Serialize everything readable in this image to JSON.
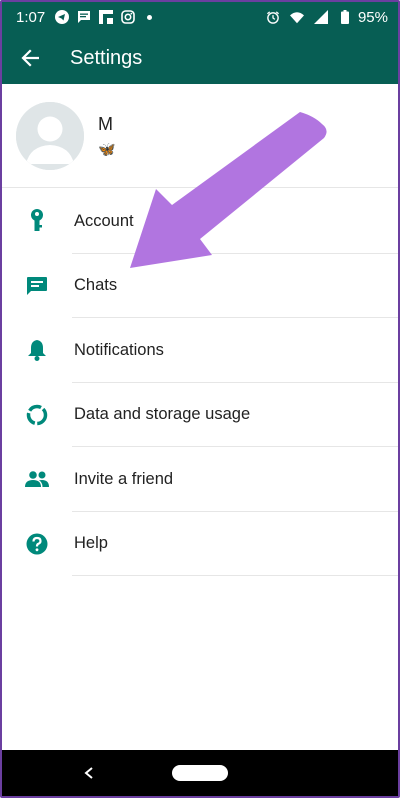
{
  "status_bar": {
    "time": "1:07",
    "battery": "95%",
    "icons": [
      "telegram-icon",
      "message-icon",
      "flipboard-icon",
      "instagram-icon",
      "dot-icon",
      "alarm-icon",
      "wifi-icon",
      "signal-icon",
      "battery-icon"
    ]
  },
  "app_bar": {
    "title": "Settings",
    "back_icon": "arrow-back-icon"
  },
  "profile": {
    "name": "M",
    "status": "🦋"
  },
  "menu": {
    "items": [
      {
        "label": "Account",
        "icon": "key-icon"
      },
      {
        "label": "Chats",
        "icon": "chat-icon"
      },
      {
        "label": "Notifications",
        "icon": "bell-icon"
      },
      {
        "label": "Data and storage usage",
        "icon": "data-usage-icon"
      },
      {
        "label": "Invite a friend",
        "icon": "people-icon"
      },
      {
        "label": "Help",
        "icon": "help-icon"
      }
    ]
  },
  "colors": {
    "primary": "#075e54",
    "accent": "#00897b",
    "arrow": "#b175e0"
  }
}
